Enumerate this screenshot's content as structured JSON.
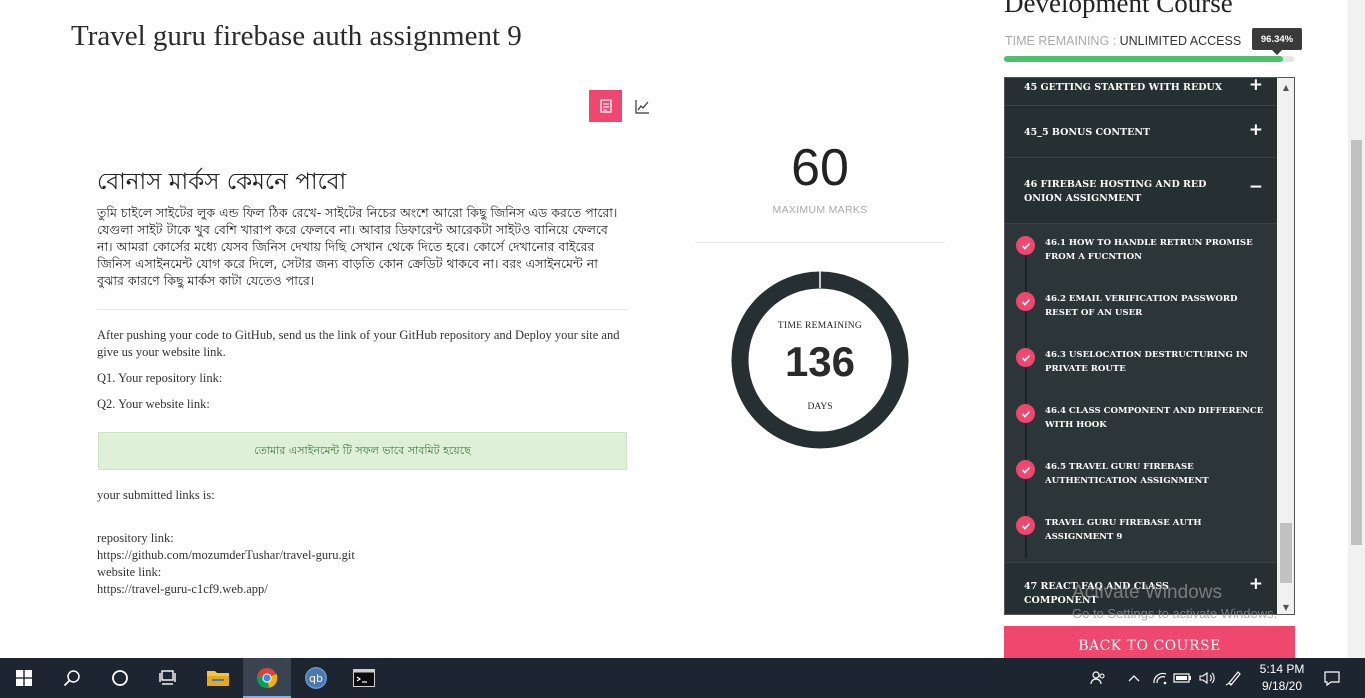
{
  "assignment": {
    "title": "Travel guru firebase auth assignment 9",
    "bonus_heading": "বোনাস মার্কস কেমনে পাবো",
    "bonus_text": "তুমি চাইলে সাইটের লুক এন্ড ফিল ঠিক রেখে- সাইটের নিচের অংশে আরো কিছু জিনিস এড করতে পারো। যেগুলা সাইট টাকে খুব বেশি খারাপ করে ফেলবে না। আবার ডিফারেন্ট আরেকটা সাইটও বানিয়ে ফেলবে না। আমরা কোর্সের মধ্যে যেসব জিনিস দেখায় দিছি সেখান থেকে দিতে হবে। কোর্সে দেখানোর বাইরের জিনিস এসাইনমেন্ট যোগ করে দিলে, সেটার জন্য বাড়তি কোন ক্রেডিট থাকবে না। বরং এসাইনমেন্ট না বুঝার কারণে কিছু মার্কস কাটা যেতেও পারে।",
    "instructions": "After pushing your code to GitHub, send us the link of your GitHub repository and Deploy your site and give us your website link.",
    "q1": "Q1. Your repository link:",
    "q2": "Q2. Your website link:",
    "success_message": "তোমার এসাইনমেন্ট টি সফল ভাবে সাবমিট হয়েছে",
    "submitted_label": "your submitted links is:",
    "repo_label": "repository link:",
    "repo_url": "https://github.com/mozumderTushar/travel-guru.git",
    "website_label": "website link:",
    "website_url": "https://travel-guru-c1cf9.web.app/"
  },
  "marks": {
    "value": "60",
    "label": "MAXIMUM MARKS"
  },
  "timer": {
    "label": "TIME REMAINING",
    "value": "136",
    "unit": "DAYS"
  },
  "course": {
    "title": "Development Course",
    "time_remaining_label": "TIME REMAINING :",
    "time_remaining_value": "UNLIMITED ACCESS",
    "progress_text": "96.34%",
    "progress_fraction": 0.9634,
    "back_button": "BACK TO COURSE"
  },
  "modules": {
    "top_partial": "45 GETTING STARTED WITH REDUX",
    "m45_5": "45_5 BONUS CONTENT",
    "m46": "46 FIREBASE HOSTING AND RED ONION ASSIGNMENT",
    "m47": "47 REACT FAQ AND CLASS COMPONENT",
    "plus": "+",
    "minus": "−",
    "lessons": [
      "46.1 HOW TO HANDLE RETRUN PROMISE FROM A FUCNTION",
      "46.2 EMAIL VERIFICATION PASSWORD RESET OF AN USER",
      "46.3 USELOCATION DESTRUCTURING IN PRIVATE ROUTE",
      "46.4 CLASS COMPONENT AND DIFFERENCE WITH HOOK",
      "46.5 TRAVEL GURU FIREBASE AUTHENTICATION ASSIGNMENT",
      "TRAVEL GURU FIREBASE AUTH ASSIGNMENT 9"
    ]
  },
  "watermark": {
    "line1": "Activate Windows",
    "line2": "Go to Settings to activate Windows."
  },
  "taskbar": {
    "time": "5:14 PM",
    "date": "9/18/20"
  }
}
